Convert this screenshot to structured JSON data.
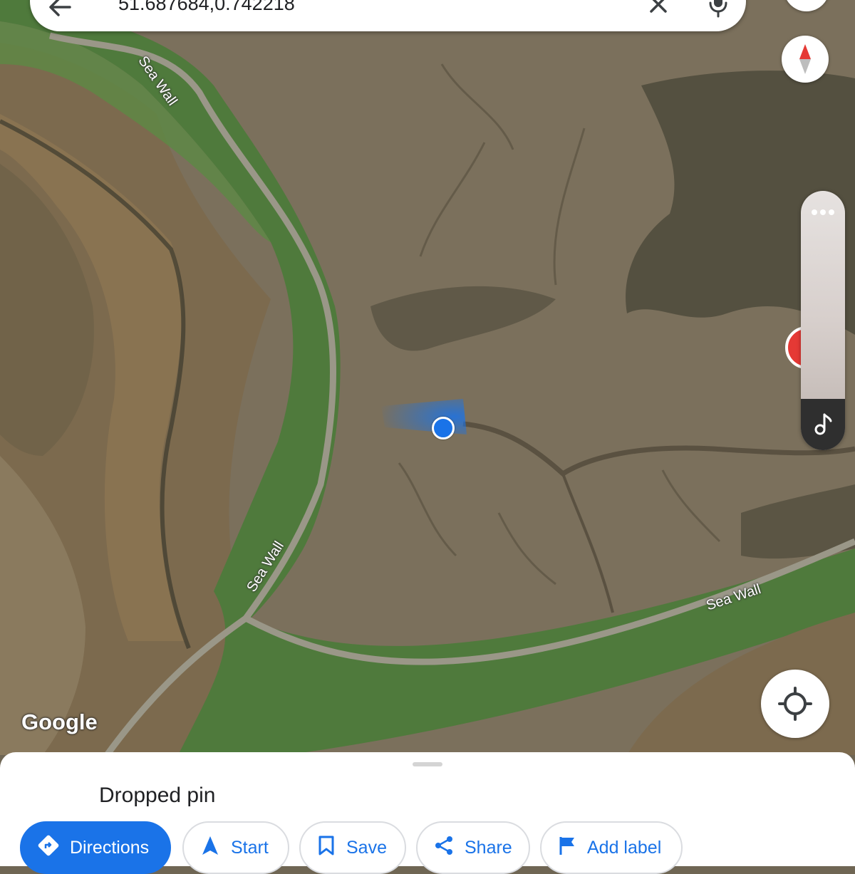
{
  "search": {
    "query": "51.687684,0.742218"
  },
  "map": {
    "road_labels": [
      "Sea Wall",
      "Sea Wall",
      "Sea Wall"
    ],
    "attribution": "Google"
  },
  "sheet": {
    "title": "Dropped pin",
    "actions": [
      {
        "label": "Directions",
        "icon": "directions-icon"
      },
      {
        "label": "Start",
        "icon": "navigation-arrow-icon"
      },
      {
        "label": "Save",
        "icon": "bookmark-icon"
      },
      {
        "label": "Share",
        "icon": "share-icon"
      },
      {
        "label": "Add label",
        "icon": "flag-icon"
      }
    ]
  },
  "colors": {
    "accent": "#1a73e8",
    "location_dot": "#1a73e8",
    "record": "#e53935",
    "mudflat": "#7b705c",
    "grass": "#4f7a3c"
  }
}
